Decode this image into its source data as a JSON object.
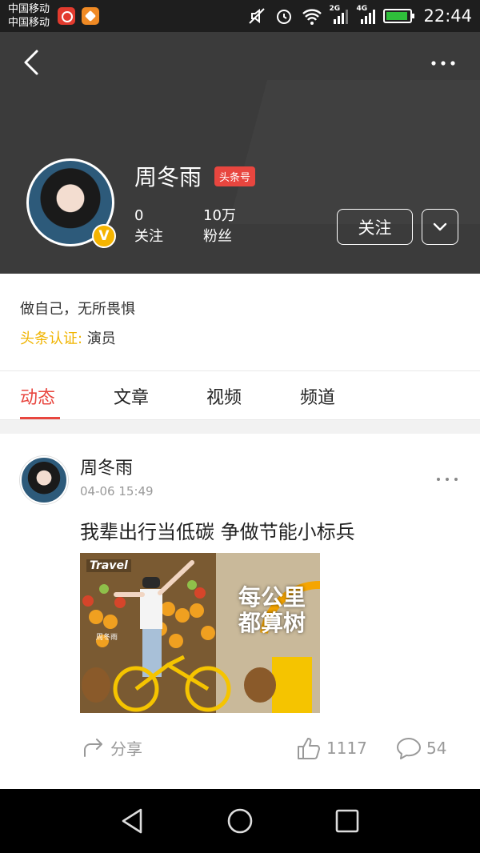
{
  "status_bar": {
    "carrier_1": "中国移动",
    "carrier_2": "中国移动",
    "net_2g": "2G",
    "net_4g": "4G",
    "time": "22:44"
  },
  "profile": {
    "name": "周冬雨",
    "badge": "头条号",
    "verified_mark": "V",
    "following_count": "0",
    "following_label": "关注",
    "fans_count": "10万",
    "fans_label": "粉丝",
    "follow_button": "关注",
    "bio": "做自己，无所畏惧",
    "cert_label": "头条认证:",
    "cert_value": "演员"
  },
  "tabs": [
    {
      "label": "动态",
      "active": true
    },
    {
      "label": "文章",
      "active": false
    },
    {
      "label": "视频",
      "active": false
    },
    {
      "label": "频道",
      "active": false
    }
  ],
  "post": {
    "author": "周冬雨",
    "time": "04-06 15:49",
    "title": "我辈出行当低碳 争做节能小标兵",
    "image_text_travel": "Travel",
    "image_text_main_1": "每公里",
    "image_text_main_2": "都算树",
    "image_caption": "周冬雨",
    "share_label": "分享",
    "likes": "1117",
    "comments": "54"
  },
  "colors": {
    "accent": "#e8463f",
    "cert": "#f0b400",
    "header_bg": "#3b3b3b"
  },
  "icons": [
    "back-icon",
    "more-icon",
    "chevron-down-icon",
    "share-icon",
    "thumb-up-icon",
    "comment-icon",
    "nav-back-icon",
    "nav-home-icon",
    "nav-recents-icon"
  ]
}
